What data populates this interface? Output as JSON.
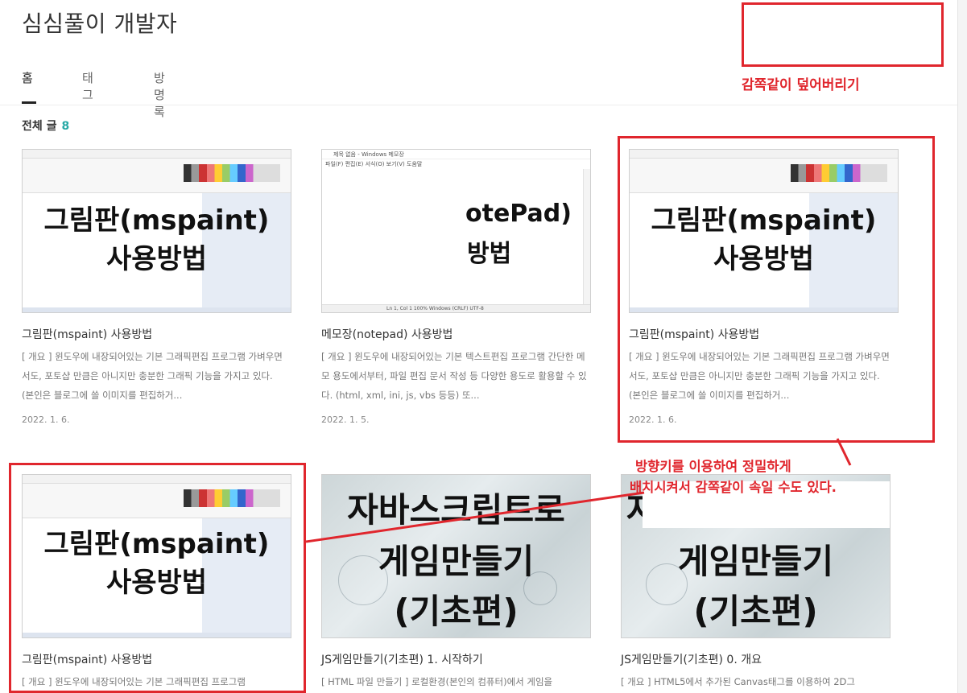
{
  "blog": {
    "title": "심심풀이 개발자"
  },
  "nav": {
    "tabs": [
      "홈",
      "태그",
      "방명록"
    ],
    "active": 0
  },
  "section": {
    "label": "전체 글",
    "count": "8"
  },
  "annotations": {
    "top_right": "감쪽같이 덮어버리기",
    "middle_line1": "방향키를 이용하여 정밀하게",
    "middle_line2": "배치시켜서 감쪽같이 속일 수도 있다."
  },
  "colors": {
    "accent": "#27a9a6",
    "annotation": "#e0262d"
  },
  "posts": [
    {
      "title": "그림판(mspaint) 사용방법",
      "excerpt": "[ 개요 ] 윈도우에 내장되어있는 기본 그래픽편집 프로그램 가벼우면서도, 포토샵 만큼은 아니지만 충분한 그래픽 기능을 가지고 있다. (본인은 블로그에 쓸 이미지를 편집하거...",
      "date": "2022. 1. 6.",
      "thumb_line1": "그림판(mspaint)",
      "thumb_line2": "사용방법"
    },
    {
      "title": "메모장(notepad) 사용방법",
      "excerpt": "[ 개요 ] 윈도우에 내장되어있는 기본 텍스트편집 프로그램 간단한 메모 용도에서부터, 파일 편집 문서 작성 등 다양한 용도로 활용할 수 있다. (html, xml, ini, js, vbs 등등) 또...",
      "date": "2022. 1. 5.",
      "thumb_titlebar": "제목 없음 - Windows 메모장",
      "thumb_menu": "파일(F)   편집(E)   서식(O)   보기(V)   도움말",
      "thumb_line1": "otePad)",
      "thumb_line2": "방법",
      "thumb_status": "Ln 1, Col 1          100%    Windows (CRLF)      UTF-8"
    },
    {
      "title": "그림판(mspaint) 사용방법",
      "excerpt": "[ 개요 ] 윈도우에 내장되어있는 기본 그래픽편집 프로그램 가벼우면서도, 포토샵 만큼은 아니지만 충분한 그래픽 기능을 가지고 있다. (본인은 블로그에 쓸 이미지를 편집하거...",
      "date": "2022. 1. 6.",
      "thumb_line1": "그림판(mspaint)",
      "thumb_line2": "사용방법"
    },
    {
      "title": "그림판(mspaint) 사용방법",
      "excerpt": "[ 개요 ] 윈도우에 내장되어있는 기본 그래픽편집 프로그램",
      "thumb_line1": "그림판(mspaint)",
      "thumb_line2": "사용방법"
    },
    {
      "title": "JS게임만들기(기초편) 1. 시작하기",
      "excerpt": "[ HTML 파일 만들기 ] 로컬환경(본인의 컴퓨터)에서 게임을",
      "thumb_line1": "자바스크립트로",
      "thumb_line2": "게임만들기",
      "thumb_line3": "(기초편)"
    },
    {
      "title": "JS게임만들기(기초편) 0. 개요",
      "excerpt": "[ 개요 ] HTML5에서 추가된 Canvas태그를 이용하여 2D그",
      "thumb_line0": "자",
      "thumb_line2": "게임만들기",
      "thumb_line3": "(기초편)"
    }
  ]
}
